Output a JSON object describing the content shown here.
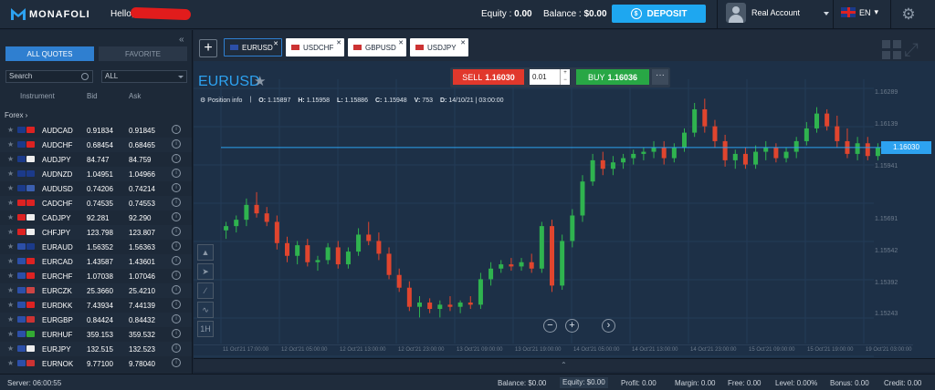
{
  "header": {
    "logo_text": "MONAFOLI",
    "hello_label": "Hello,",
    "equity_label": "Equity :",
    "equity_value": "0.00",
    "balance_label": "Balance :",
    "balance_value": "$0.00",
    "deposit_label": "DEPOSIT",
    "account_label": "Real Account",
    "language": "EN"
  },
  "sidebar": {
    "tabs": {
      "all": "ALL QUOTES",
      "favorite": "FAVORITE"
    },
    "search_placeholder": "Search",
    "filter_value": "ALL",
    "columns": {
      "instrument": "Instrument",
      "bid": "Bid",
      "ask": "Ask"
    },
    "section": "Forex ›",
    "rows": [
      {
        "symbol": "AUDCAD",
        "bid": "0.91834",
        "ask": "0.91845",
        "c1": "#1b3a8a",
        "c2": "#d22"
      },
      {
        "symbol": "AUDCHF",
        "bid": "0.68454",
        "ask": "0.68465",
        "c1": "#1b3a8a",
        "c2": "#d22"
      },
      {
        "symbol": "AUDJPY",
        "bid": "84.747",
        "ask": "84.759",
        "c1": "#1b3a8a",
        "c2": "#eee"
      },
      {
        "symbol": "AUDNZD",
        "bid": "1.04951",
        "ask": "1.04966",
        "c1": "#1b3a8a",
        "c2": "#1b3a8a"
      },
      {
        "symbol": "AUDUSD",
        "bid": "0.74206",
        "ask": "0.74214",
        "c1": "#1b3a8a",
        "c2": "#3b5fb0"
      },
      {
        "symbol": "CADCHF",
        "bid": "0.74535",
        "ask": "0.74553",
        "c1": "#d22",
        "c2": "#d22"
      },
      {
        "symbol": "CADJPY",
        "bid": "92.281",
        "ask": "92.290",
        "c1": "#d22",
        "c2": "#eee"
      },
      {
        "symbol": "CHFJPY",
        "bid": "123.798",
        "ask": "123.807",
        "c1": "#d22",
        "c2": "#eee"
      },
      {
        "symbol": "EURAUD",
        "bid": "1.56352",
        "ask": "1.56363",
        "c1": "#2c4fa8",
        "c2": "#1b3a8a"
      },
      {
        "symbol": "EURCAD",
        "bid": "1.43587",
        "ask": "1.43601",
        "c1": "#2c4fa8",
        "c2": "#d22"
      },
      {
        "symbol": "EURCHF",
        "bid": "1.07038",
        "ask": "1.07046",
        "c1": "#2c4fa8",
        "c2": "#d22"
      },
      {
        "symbol": "EURCZK",
        "bid": "25.3660",
        "ask": "25.4210",
        "c1": "#2c4fa8",
        "c2": "#c44"
      },
      {
        "symbol": "EURDKK",
        "bid": "7.43934",
        "ask": "7.44139",
        "c1": "#2c4fa8",
        "c2": "#d22"
      },
      {
        "symbol": "EURGBP",
        "bid": "0.84424",
        "ask": "0.84432",
        "c1": "#2c4fa8",
        "c2": "#c33"
      },
      {
        "symbol": "EURHUF",
        "bid": "359.153",
        "ask": "359.532",
        "c1": "#2c4fa8",
        "c2": "#3a3"
      },
      {
        "symbol": "EURJPY",
        "bid": "132.515",
        "ask": "132.523",
        "c1": "#2c4fa8",
        "c2": "#eee"
      },
      {
        "symbol": "EURNOK",
        "bid": "9.77100",
        "ask": "9.78040",
        "c1": "#2c4fa8",
        "c2": "#c33"
      }
    ]
  },
  "chart_tabs": [
    {
      "label": "EURUSD",
      "active": true
    },
    {
      "label": "USDCHF",
      "active": false
    },
    {
      "label": "GBPUSD",
      "active": false
    },
    {
      "label": "USDJPY",
      "active": false
    }
  ],
  "chart": {
    "pair": "EURUSD",
    "sell_label": "SELL",
    "sell_price": "1.16030",
    "lot": "0.01",
    "buy_label": "BUY",
    "buy_price": "1.16036",
    "position_info": "Position info",
    "ohlc": {
      "o": "1.15897",
      "h": "1.15958",
      "l": "1.15886",
      "c": "1.15948",
      "v": "753",
      "d": "14/10/21 | 03:00:00"
    },
    "current_price": "1.16030",
    "price_axis": [
      "1.16289",
      "1.16139",
      "1.15941",
      "1.15691",
      "1.15542",
      "1.15392",
      "1.15243"
    ],
    "time_axis": [
      "11 Oct'21 17:00:00",
      "12 Oct'21 05:00:00",
      "12 Oct'21 13:00:00",
      "12 Oct'21 23:00:00",
      "13 Oct'21 09:00:00",
      "13 Oct'21 19:00:00",
      "14 Oct'21 05:00:00",
      "14 Oct'21 13:00:00",
      "14 Oct'21 23:00:00",
      "15 Oct'21 09:00:00",
      "15 Oct'21 19:00:00",
      "19 Oct'21 03:00:00"
    ],
    "up_color": "#2fb34f",
    "down_color": "#e0452e"
  },
  "chart_data": {
    "type": "candlestick",
    "title": "EURUSD",
    "ylim": [
      1.1515,
      1.1636
    ],
    "candles": [
      [
        1.1564,
        1.1568,
        1.156,
        1.1566
      ],
      [
        1.1566,
        1.1571,
        1.1563,
        1.1569
      ],
      [
        1.1569,
        1.1579,
        1.1566,
        1.1576
      ],
      [
        1.1576,
        1.1582,
        1.157,
        1.1572
      ],
      [
        1.1572,
        1.1575,
        1.1566,
        1.1568
      ],
      [
        1.1568,
        1.1571,
        1.1555,
        1.1558
      ],
      [
        1.1558,
        1.1561,
        1.1549,
        1.1552
      ],
      [
        1.1552,
        1.1559,
        1.1548,
        1.1557
      ],
      [
        1.1557,
        1.156,
        1.1547,
        1.1549
      ],
      [
        1.1549,
        1.1552,
        1.1545,
        1.155
      ],
      [
        1.155,
        1.1558,
        1.1548,
        1.1556
      ],
      [
        1.1556,
        1.1559,
        1.1546,
        1.1548
      ],
      [
        1.1548,
        1.1556,
        1.1546,
        1.1554
      ],
      [
        1.1554,
        1.1565,
        1.1552,
        1.1562
      ],
      [
        1.1562,
        1.1568,
        1.1557,
        1.1559
      ],
      [
        1.1559,
        1.1563,
        1.155,
        1.1553
      ],
      [
        1.1553,
        1.1556,
        1.1541,
        1.1543
      ],
      [
        1.1543,
        1.1546,
        1.1535,
        1.1537
      ],
      [
        1.1537,
        1.154,
        1.1526,
        1.1528
      ],
      [
        1.1528,
        1.1533,
        1.1523,
        1.153
      ],
      [
        1.153,
        1.1532,
        1.1525,
        1.1527
      ],
      [
        1.1527,
        1.1531,
        1.1523,
        1.1529
      ],
      [
        1.1529,
        1.1533,
        1.1526,
        1.1528
      ],
      [
        1.1528,
        1.1531,
        1.1525,
        1.153
      ],
      [
        1.153,
        1.1533,
        1.1527,
        1.1529
      ],
      [
        1.1529,
        1.1544,
        1.1527,
        1.1541
      ],
      [
        1.1541,
        1.1549,
        1.1538,
        1.1546
      ],
      [
        1.1546,
        1.155,
        1.1544,
        1.1548
      ],
      [
        1.1548,
        1.1551,
        1.1545,
        1.1547
      ],
      [
        1.1547,
        1.1551,
        1.1545,
        1.1549
      ],
      [
        1.1549,
        1.1553,
        1.1544,
        1.1546
      ],
      [
        1.1546,
        1.1568,
        1.1544,
        1.1566
      ],
      [
        1.1566,
        1.1569,
        1.1535,
        1.1538
      ],
      [
        1.1538,
        1.1562,
        1.1536,
        1.1559
      ],
      [
        1.1559,
        1.1574,
        1.1556,
        1.1571
      ],
      [
        1.1571,
        1.159,
        1.1568,
        1.1587
      ],
      [
        1.1587,
        1.16,
        1.1585,
        1.1597
      ],
      [
        1.1597,
        1.1601,
        1.159,
        1.1593
      ],
      [
        1.1593,
        1.1599,
        1.159,
        1.1596
      ],
      [
        1.1596,
        1.16,
        1.1593,
        1.1598
      ],
      [
        1.1598,
        1.1602,
        1.1595,
        1.16
      ],
      [
        1.16,
        1.1603,
        1.1597,
        1.1601
      ],
      [
        1.1601,
        1.1606,
        1.1598,
        1.1603
      ],
      [
        1.1603,
        1.1606,
        1.1595,
        1.1598
      ],
      [
        1.1598,
        1.1605,
        1.1596,
        1.1603
      ],
      [
        1.1603,
        1.1612,
        1.1601,
        1.161
      ],
      [
        1.161,
        1.1624,
        1.1608,
        1.1621
      ],
      [
        1.1621,
        1.1626,
        1.161,
        1.1613
      ],
      [
        1.1613,
        1.1616,
        1.1603,
        1.1606
      ],
      [
        1.1606,
        1.1609,
        1.1594,
        1.1597
      ],
      [
        1.1597,
        1.1602,
        1.1593,
        1.16
      ],
      [
        1.16,
        1.1603,
        1.1593,
        1.1595
      ],
      [
        1.1595,
        1.1604,
        1.1593,
        1.1601
      ],
      [
        1.1601,
        1.1606,
        1.1597,
        1.1603
      ],
      [
        1.1603,
        1.1605,
        1.1596,
        1.1598
      ],
      [
        1.1598,
        1.1603,
        1.1596,
        1.1601
      ],
      [
        1.1601,
        1.1608,
        1.1598,
        1.1606
      ],
      [
        1.1606,
        1.1615,
        1.1604,
        1.1612
      ],
      [
        1.1612,
        1.1622,
        1.161,
        1.1619
      ],
      [
        1.1619,
        1.1621,
        1.1611,
        1.1613
      ],
      [
        1.1613,
        1.1618,
        1.1603,
        1.1606
      ],
      [
        1.1606,
        1.1612,
        1.1598,
        1.16
      ],
      [
        1.16,
        1.1608,
        1.1597,
        1.1605
      ],
      [
        1.1605,
        1.1608,
        1.1597,
        1.1599
      ],
      [
        1.1599,
        1.1605,
        1.1597,
        1.1603
      ]
    ]
  },
  "footer": {
    "server": "Server: 06:00:55",
    "items": [
      {
        "label": "Balance:",
        "value": "$0.00"
      },
      {
        "label": "Equity:",
        "value": "$0.00"
      },
      {
        "label": "Profit:",
        "value": "0.00"
      },
      {
        "label": "Margin:",
        "value": "0.00"
      },
      {
        "label": "Free:",
        "value": "0.00"
      },
      {
        "label": "Level:",
        "value": "0.00%"
      },
      {
        "label": "Bonus:",
        "value": "0.00"
      },
      {
        "label": "Credit:",
        "value": "0.00"
      }
    ]
  }
}
